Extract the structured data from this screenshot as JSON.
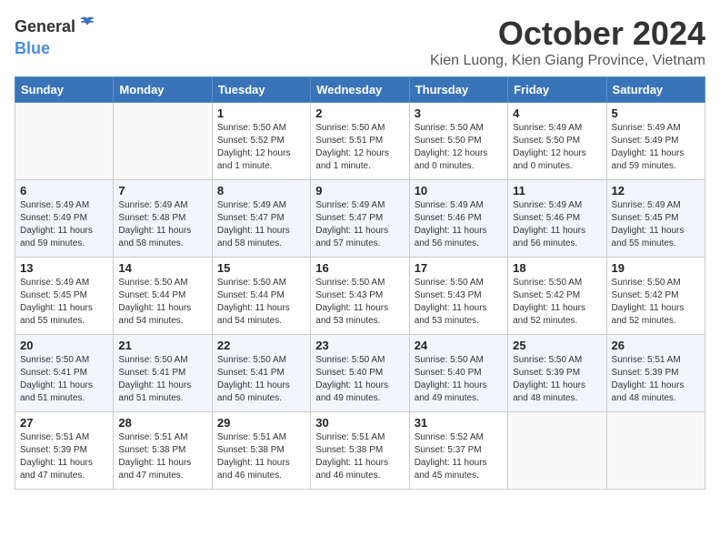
{
  "header": {
    "logo_general": "General",
    "logo_blue": "Blue",
    "month": "October 2024",
    "location": "Kien Luong, Kien Giang Province, Vietnam"
  },
  "weekdays": [
    "Sunday",
    "Monday",
    "Tuesday",
    "Wednesday",
    "Thursday",
    "Friday",
    "Saturday"
  ],
  "weeks": [
    [
      {
        "day": "",
        "info": ""
      },
      {
        "day": "",
        "info": ""
      },
      {
        "day": "1",
        "info": "Sunrise: 5:50 AM\nSunset: 5:52 PM\nDaylight: 12 hours\nand 1 minute."
      },
      {
        "day": "2",
        "info": "Sunrise: 5:50 AM\nSunset: 5:51 PM\nDaylight: 12 hours\nand 1 minute."
      },
      {
        "day": "3",
        "info": "Sunrise: 5:50 AM\nSunset: 5:50 PM\nDaylight: 12 hours\nand 0 minutes."
      },
      {
        "day": "4",
        "info": "Sunrise: 5:49 AM\nSunset: 5:50 PM\nDaylight: 12 hours\nand 0 minutes."
      },
      {
        "day": "5",
        "info": "Sunrise: 5:49 AM\nSunset: 5:49 PM\nDaylight: 11 hours\nand 59 minutes."
      }
    ],
    [
      {
        "day": "6",
        "info": "Sunrise: 5:49 AM\nSunset: 5:49 PM\nDaylight: 11 hours\nand 59 minutes."
      },
      {
        "day": "7",
        "info": "Sunrise: 5:49 AM\nSunset: 5:48 PM\nDaylight: 11 hours\nand 58 minutes."
      },
      {
        "day": "8",
        "info": "Sunrise: 5:49 AM\nSunset: 5:47 PM\nDaylight: 11 hours\nand 58 minutes."
      },
      {
        "day": "9",
        "info": "Sunrise: 5:49 AM\nSunset: 5:47 PM\nDaylight: 11 hours\nand 57 minutes."
      },
      {
        "day": "10",
        "info": "Sunrise: 5:49 AM\nSunset: 5:46 PM\nDaylight: 11 hours\nand 56 minutes."
      },
      {
        "day": "11",
        "info": "Sunrise: 5:49 AM\nSunset: 5:46 PM\nDaylight: 11 hours\nand 56 minutes."
      },
      {
        "day": "12",
        "info": "Sunrise: 5:49 AM\nSunset: 5:45 PM\nDaylight: 11 hours\nand 55 minutes."
      }
    ],
    [
      {
        "day": "13",
        "info": "Sunrise: 5:49 AM\nSunset: 5:45 PM\nDaylight: 11 hours\nand 55 minutes."
      },
      {
        "day": "14",
        "info": "Sunrise: 5:50 AM\nSunset: 5:44 PM\nDaylight: 11 hours\nand 54 minutes."
      },
      {
        "day": "15",
        "info": "Sunrise: 5:50 AM\nSunset: 5:44 PM\nDaylight: 11 hours\nand 54 minutes."
      },
      {
        "day": "16",
        "info": "Sunrise: 5:50 AM\nSunset: 5:43 PM\nDaylight: 11 hours\nand 53 minutes."
      },
      {
        "day": "17",
        "info": "Sunrise: 5:50 AM\nSunset: 5:43 PM\nDaylight: 11 hours\nand 53 minutes."
      },
      {
        "day": "18",
        "info": "Sunrise: 5:50 AM\nSunset: 5:42 PM\nDaylight: 11 hours\nand 52 minutes."
      },
      {
        "day": "19",
        "info": "Sunrise: 5:50 AM\nSunset: 5:42 PM\nDaylight: 11 hours\nand 52 minutes."
      }
    ],
    [
      {
        "day": "20",
        "info": "Sunrise: 5:50 AM\nSunset: 5:41 PM\nDaylight: 11 hours\nand 51 minutes."
      },
      {
        "day": "21",
        "info": "Sunrise: 5:50 AM\nSunset: 5:41 PM\nDaylight: 11 hours\nand 51 minutes."
      },
      {
        "day": "22",
        "info": "Sunrise: 5:50 AM\nSunset: 5:41 PM\nDaylight: 11 hours\nand 50 minutes."
      },
      {
        "day": "23",
        "info": "Sunrise: 5:50 AM\nSunset: 5:40 PM\nDaylight: 11 hours\nand 49 minutes."
      },
      {
        "day": "24",
        "info": "Sunrise: 5:50 AM\nSunset: 5:40 PM\nDaylight: 11 hours\nand 49 minutes."
      },
      {
        "day": "25",
        "info": "Sunrise: 5:50 AM\nSunset: 5:39 PM\nDaylight: 11 hours\nand 48 minutes."
      },
      {
        "day": "26",
        "info": "Sunrise: 5:51 AM\nSunset: 5:39 PM\nDaylight: 11 hours\nand 48 minutes."
      }
    ],
    [
      {
        "day": "27",
        "info": "Sunrise: 5:51 AM\nSunset: 5:39 PM\nDaylight: 11 hours\nand 47 minutes."
      },
      {
        "day": "28",
        "info": "Sunrise: 5:51 AM\nSunset: 5:38 PM\nDaylight: 11 hours\nand 47 minutes."
      },
      {
        "day": "29",
        "info": "Sunrise: 5:51 AM\nSunset: 5:38 PM\nDaylight: 11 hours\nand 46 minutes."
      },
      {
        "day": "30",
        "info": "Sunrise: 5:51 AM\nSunset: 5:38 PM\nDaylight: 11 hours\nand 46 minutes."
      },
      {
        "day": "31",
        "info": "Sunrise: 5:52 AM\nSunset: 5:37 PM\nDaylight: 11 hours\nand 45 minutes."
      },
      {
        "day": "",
        "info": ""
      },
      {
        "day": "",
        "info": ""
      }
    ]
  ]
}
